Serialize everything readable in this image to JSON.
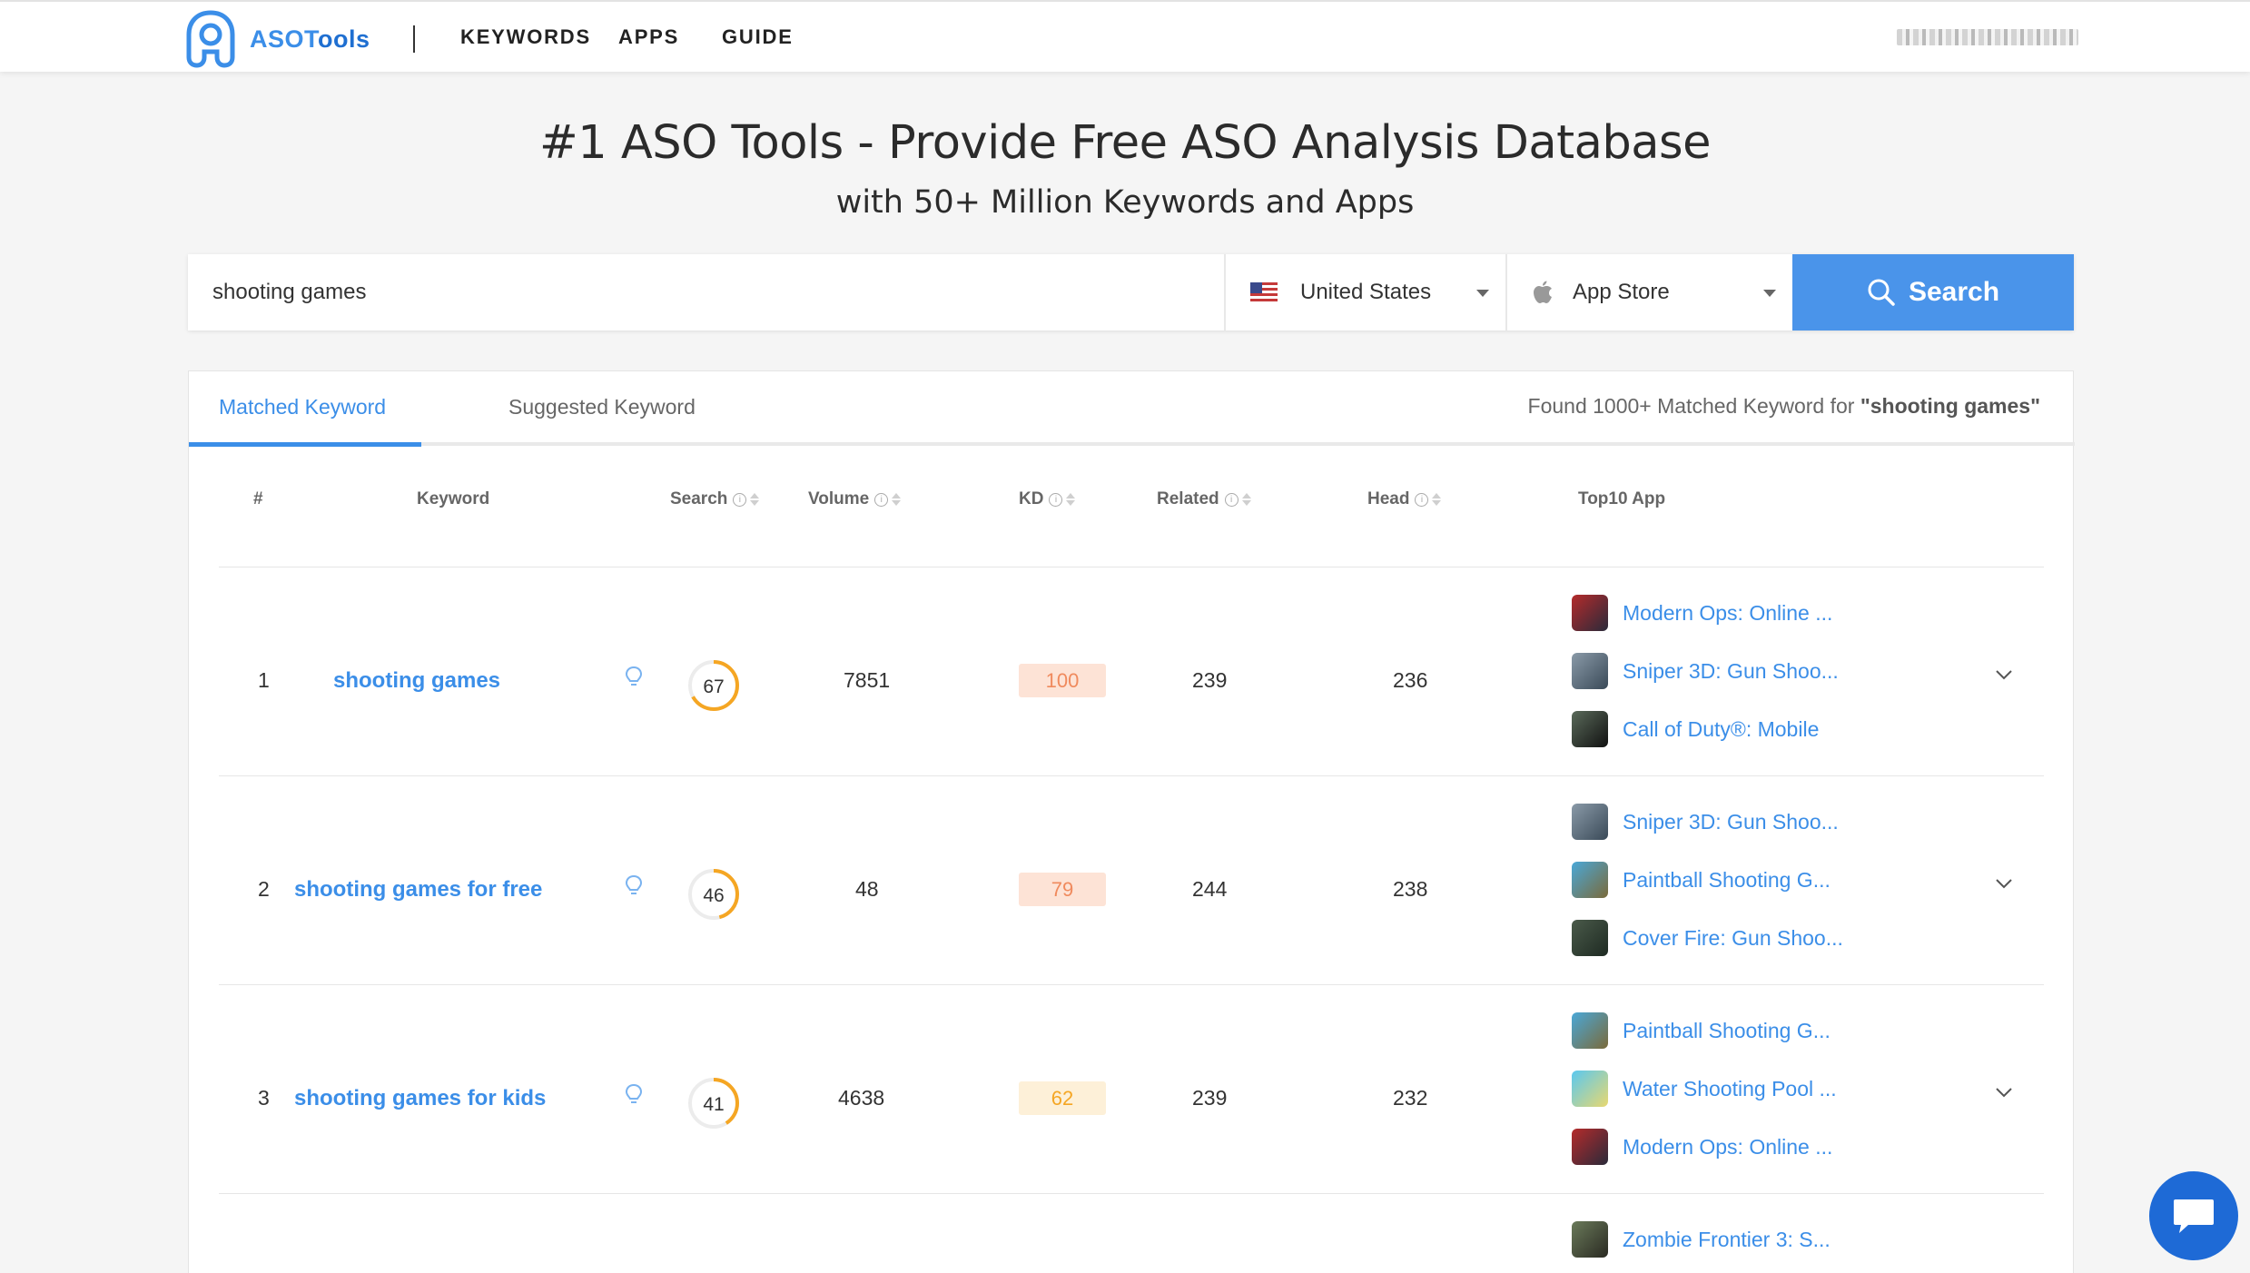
{
  "nav": {
    "logo_part1": "ASOT",
    "logo_part2": "ools",
    "links": [
      "KEYWORDS",
      "APPS",
      "GUIDE"
    ]
  },
  "hero": {
    "title": "#1 ASO Tools - Provide Free ASO Analysis Database",
    "subtitle": "with 50+ Million Keywords and Apps"
  },
  "search": {
    "query": "shooting games",
    "country": "United States",
    "store": "App Store",
    "button_label": "Search"
  },
  "tabs": {
    "matched": "Matched Keyword",
    "suggested": "Suggested Keyword",
    "found_prefix": "Found  1000+  Matched Keyword for ",
    "found_query": "\"shooting games\""
  },
  "table": {
    "headers": {
      "num": "#",
      "keyword": "Keyword",
      "search": "Search",
      "volume": "Volume",
      "kd": "KD",
      "related": "Related",
      "head": "Head",
      "top10": "Top10 App"
    },
    "rows": [
      {
        "num": "1",
        "keyword": "shooting games",
        "search": "67",
        "search_pct": 0.67,
        "volume": "7851",
        "kd": "100",
        "related": "239",
        "head": "236",
        "apps": [
          "Modern Ops: Online ...",
          "Sniper 3D: Gun Shoo...",
          "Call of Duty®: Mobile"
        ]
      },
      {
        "num": "2",
        "keyword": "shooting games for free",
        "search": "46",
        "search_pct": 0.46,
        "volume": "48",
        "kd": "79",
        "related": "244",
        "head": "238",
        "apps": [
          "Sniper 3D: Gun Shoo...",
          "Paintball Shooting G...",
          "Cover Fire: Gun Shoo..."
        ]
      },
      {
        "num": "3",
        "keyword": "shooting games for kids",
        "search": "41",
        "search_pct": 0.41,
        "volume": "4638",
        "kd": "62",
        "related": "239",
        "head": "232",
        "apps": [
          "Paintball Shooting G...",
          "Water Shooting Pool ...",
          "Modern Ops: Online ..."
        ]
      },
      {
        "apps": [
          "Zombie Frontier 3: S..."
        ]
      }
    ]
  },
  "colors": {
    "accent": "#3b8ee8",
    "search_button": "#4a94ea",
    "gauge": "#f5a623",
    "kd_high_bg": "#fde3d6",
    "kd_high_text": "#f08a5d",
    "kd_mid_bg": "#fdf0d8",
    "kd_mid_text": "#f5a623"
  },
  "icons": [
    "logo-icon",
    "flag-us-icon",
    "apple-icon",
    "search-icon",
    "bulb-icon",
    "info-icon",
    "sort-icon",
    "chevron-down-icon",
    "chat-icon"
  ]
}
